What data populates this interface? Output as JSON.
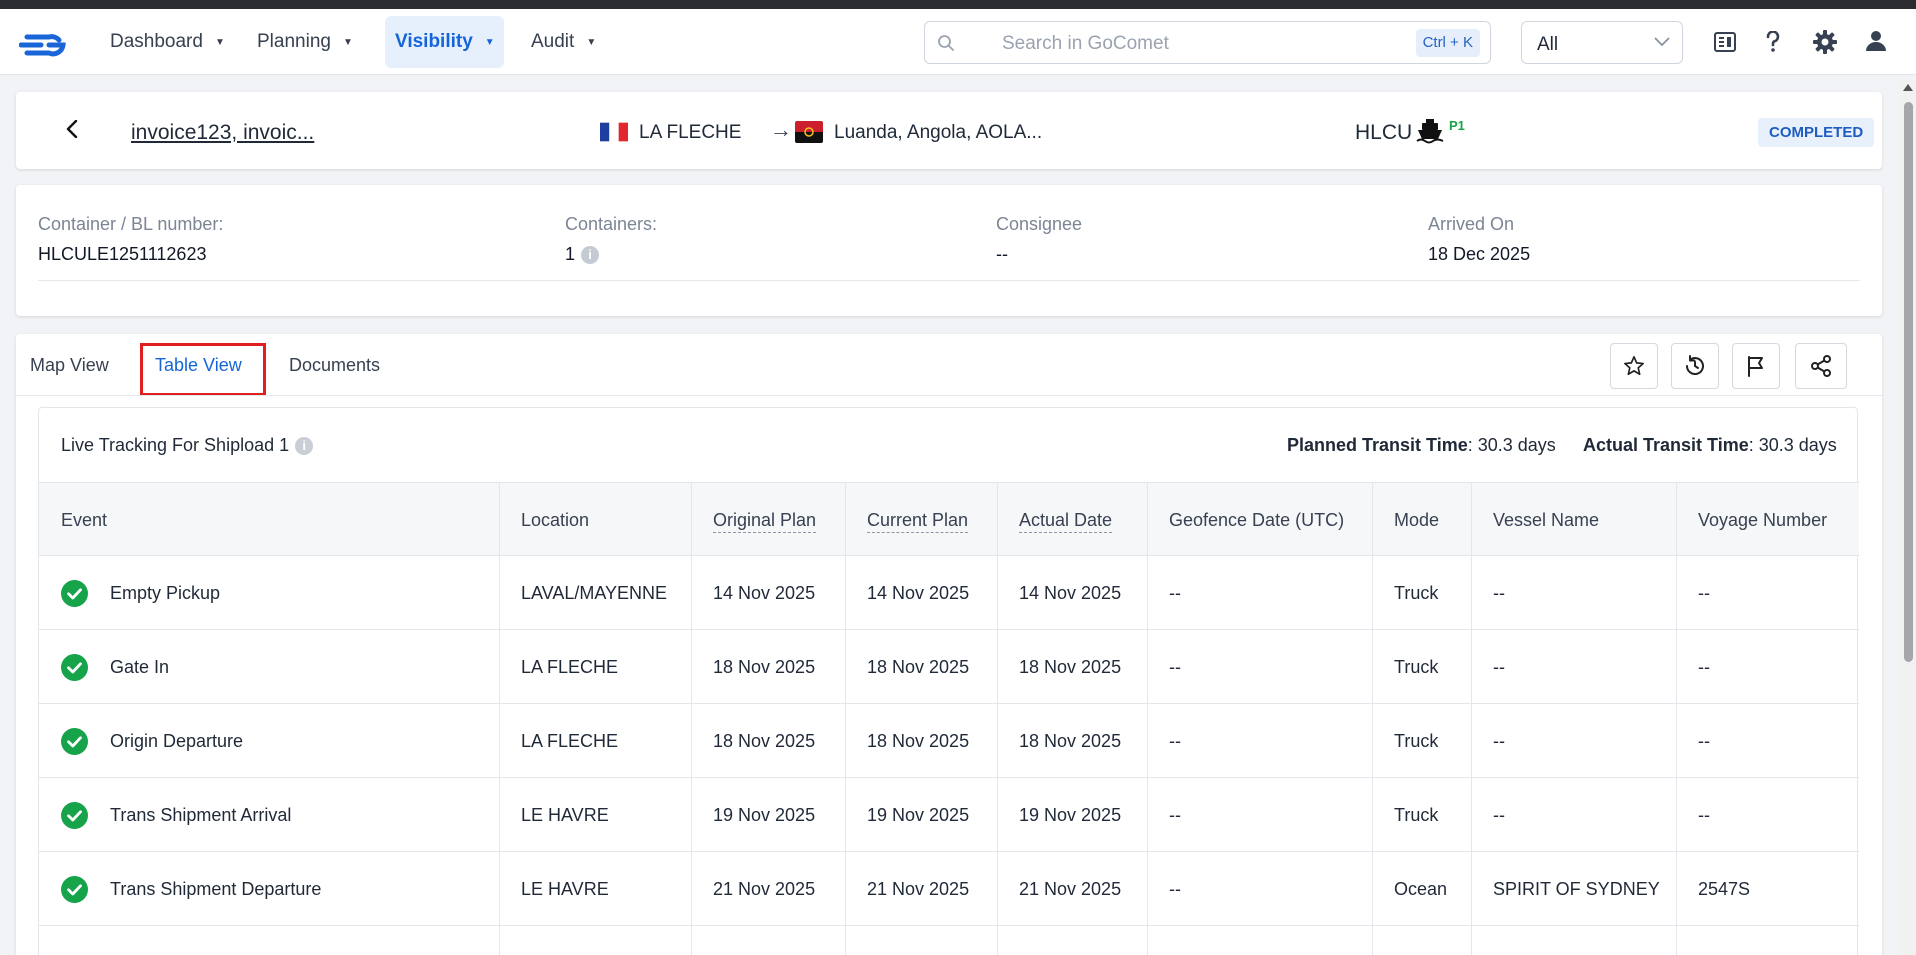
{
  "nav": {
    "items": [
      {
        "label": "Dashboard"
      },
      {
        "label": "Planning"
      },
      {
        "label": "Visibility"
      },
      {
        "label": "Audit"
      }
    ],
    "search_placeholder": "Search in GoComet",
    "search_shortcut": "Ctrl + K",
    "scope_value": "All"
  },
  "shipment": {
    "ref": "invoice123, invoic...",
    "origin": "LA FLECHE",
    "destination": "Luanda, Angola, AOLA...",
    "carrier": "HLCU",
    "priority": "P1",
    "status": "COMPLETED"
  },
  "info": {
    "bl_label": "Container / BL number:",
    "bl_value": "HLCULE1251112623",
    "containers_label": "Containers:",
    "containers_value": "1",
    "consignee_label": "Consignee",
    "consignee_value": "--",
    "arrived_label": "Arrived On",
    "arrived_value": "18 Dec 2025"
  },
  "tabs": {
    "map": "Map View",
    "table": "Table View",
    "documents": "Documents"
  },
  "tracking": {
    "title": "Live Tracking For Shipload 1",
    "planned_label": "Planned Transit Time",
    "planned_value": ": 30.3 days",
    "actual_label": "Actual Transit Time",
    "actual_value": ": 30.3 days"
  },
  "table": {
    "headers": {
      "event": "Event",
      "location": "Location",
      "original_plan": "Original Plan",
      "current_plan": "Current Plan",
      "actual_date": "Actual Date",
      "geofence": "Geofence Date (UTC)",
      "mode": "Mode",
      "vessel": "Vessel Name",
      "voyage": "Voyage Number"
    },
    "rows": [
      {
        "event": "Empty Pickup",
        "location": "LAVAL/MAYENNE",
        "original": "14 Nov 2025",
        "current": "14 Nov 2025",
        "actual": "14 Nov 2025",
        "geofence": "--",
        "mode": "Truck",
        "vessel": "--",
        "voyage": "--"
      },
      {
        "event": "Gate In",
        "location": "LA FLECHE",
        "original": "18 Nov 2025",
        "current": "18 Nov 2025",
        "actual": "18 Nov 2025",
        "geofence": "--",
        "mode": "Truck",
        "vessel": "--",
        "voyage": "--"
      },
      {
        "event": "Origin Departure",
        "location": "LA FLECHE",
        "original": "18 Nov 2025",
        "current": "18 Nov 2025",
        "actual": "18 Nov 2025",
        "geofence": "--",
        "mode": "Truck",
        "vessel": "--",
        "voyage": "--"
      },
      {
        "event": "Trans Shipment Arrival",
        "location": "LE HAVRE",
        "original": "19 Nov 2025",
        "current": "19 Nov 2025",
        "actual": "19 Nov 2025",
        "geofence": "--",
        "mode": "Truck",
        "vessel": "--",
        "voyage": "--"
      },
      {
        "event": "Trans Shipment Departure",
        "location": "LE HAVRE",
        "original": "21 Nov 2025",
        "current": "21 Nov 2025",
        "actual": "21 Nov 2025",
        "geofence": "--",
        "mode": "Ocean",
        "vessel": "SPIRIT OF SYDNEY",
        "voyage": "2547S"
      }
    ]
  },
  "colors": {
    "accent": "#1565d8",
    "success": "#16a34a",
    "highlight": "#e0201e"
  }
}
